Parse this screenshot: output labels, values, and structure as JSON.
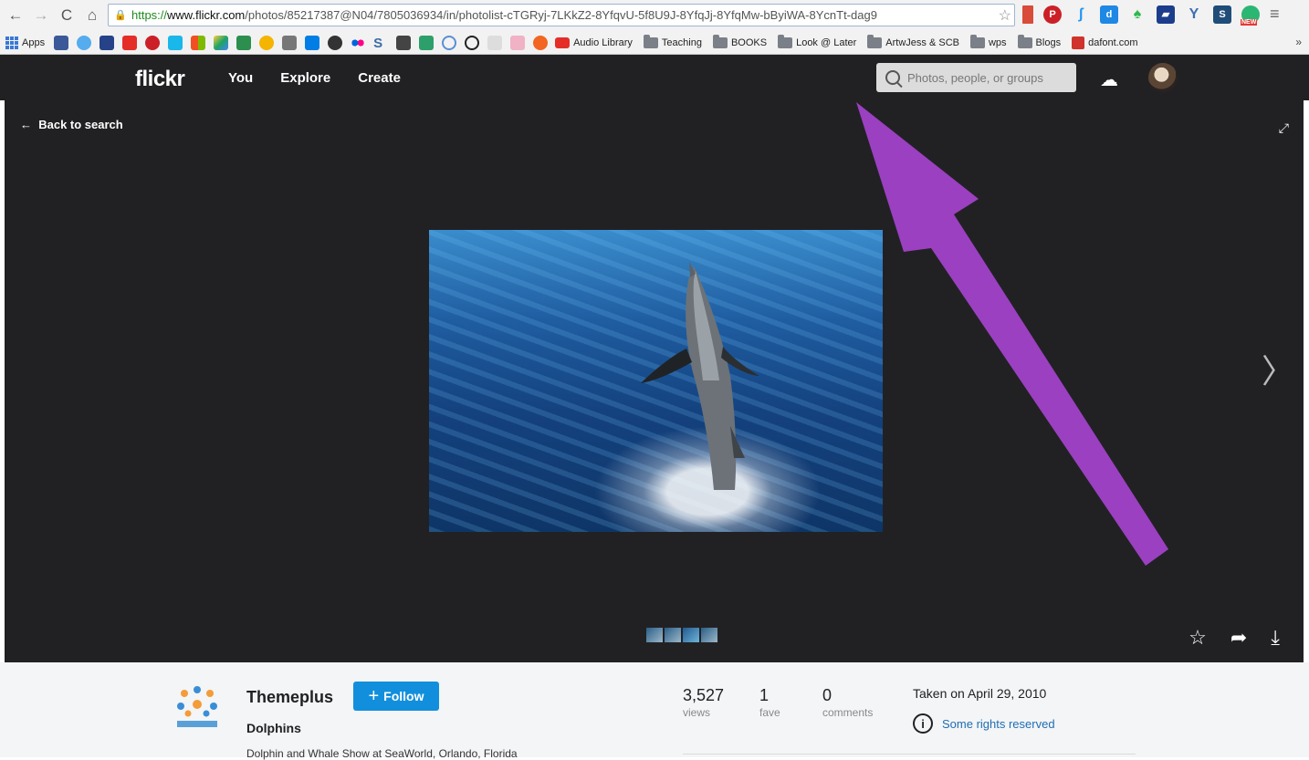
{
  "browser": {
    "url_scheme": "https://",
    "url_host": "www.flickr.com",
    "url_path": "/photos/85217387@N04/7805036934/in/photolist-cTGRyj-7LKkZ2-8YfqvU-5f8U9J-8YfqJj-8YfqMw-bByiWA-8YcnTt-dag9",
    "bookmarks": {
      "apps": "Apps",
      "audio_library": "Audio Library",
      "folders": [
        "Teaching",
        "BOOKS",
        "Look @ Later",
        "ArtwJess & SCB",
        "wps",
        "Blogs"
      ],
      "dafont": "dafont.com",
      "more": "»"
    },
    "new_badge": "NEW"
  },
  "flickr": {
    "logo": "flickr",
    "nav": [
      "You",
      "Explore",
      "Create"
    ],
    "search_placeholder": "Photos, people, or groups",
    "back_label": "Back to search"
  },
  "photo_info": {
    "owner": "Themeplus",
    "follow_label": "Follow",
    "title": "Dolphins",
    "description": "Dolphin and Whale Show at SeaWorld, Orlando, Florida",
    "stats": [
      {
        "num": "3,527",
        "label": "views"
      },
      {
        "num": "1",
        "label": "fave"
      },
      {
        "num": "0",
        "label": "comments"
      }
    ],
    "taken": "Taken on April 29, 2010",
    "rights": "Some rights reserved"
  },
  "colors": {
    "flickr_dark": "#212124",
    "follow_blue": "#128fdc",
    "annotation_purple": "#9b40c0"
  }
}
